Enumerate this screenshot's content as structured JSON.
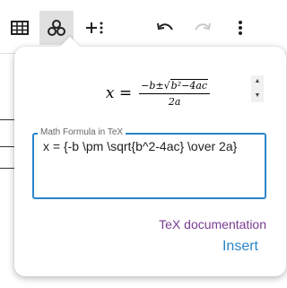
{
  "toolbar": {
    "buttons": [
      {
        "icon": "table-icon"
      },
      {
        "icon": "math-icon",
        "active": true
      },
      {
        "icon": "insert-more-icon"
      },
      {
        "icon": "undo-icon"
      },
      {
        "icon": "redo-icon",
        "disabled": true
      },
      {
        "icon": "more-vert-icon"
      }
    ]
  },
  "formula_preview": {
    "lhs": "x",
    "eq": "=",
    "numerator_prefix": "−b±",
    "radicand": "b²−4ac",
    "denominator": "2a"
  },
  "tex_field": {
    "label": "Math Formula in TeX",
    "value": "x = {-b \\pm \\sqrt{b^2-4ac} \\over 2a}"
  },
  "links": {
    "tex_documentation": "TeX documentation"
  },
  "actions": {
    "insert": "Insert"
  },
  "colors": {
    "accent": "#2a85c9",
    "link": "#7a3b91",
    "active_button_bg": "#e0e0e0"
  }
}
